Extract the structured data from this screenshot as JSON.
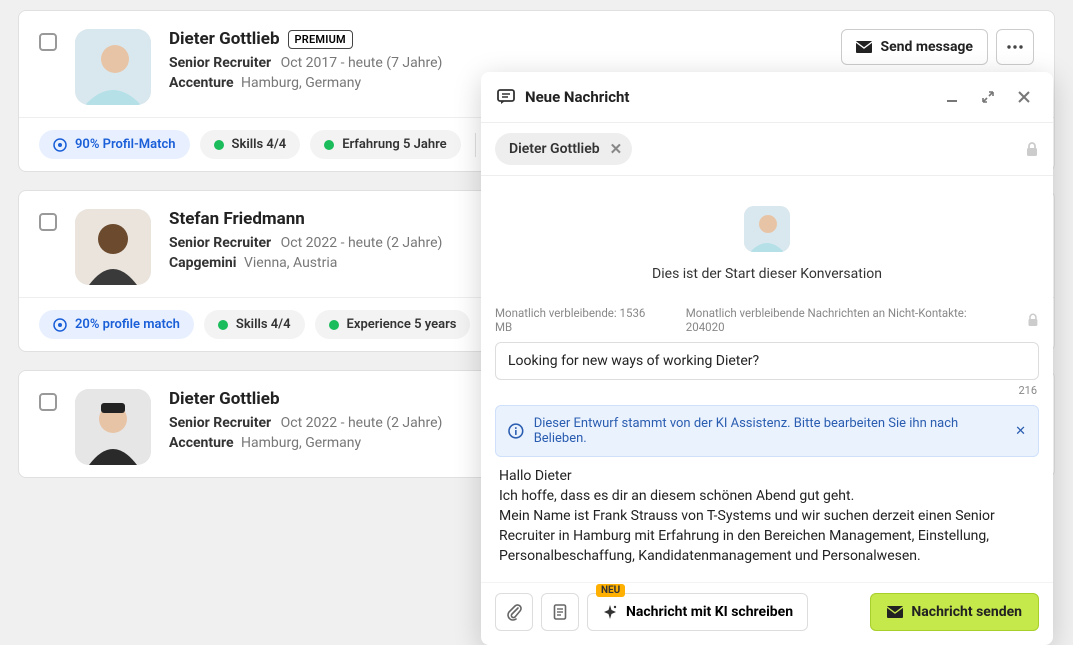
{
  "candidates": [
    {
      "name": "Dieter Gottlieb",
      "premium": "PREMIUM",
      "role": "Senior Recruiter",
      "period": "Oct 2017 - heute (7 Jahre)",
      "company": "Accenture",
      "location": "Hamburg, Germany",
      "send_label": "Send message",
      "tags": {
        "match": "90% Profil-Match",
        "skills": "Skills 4/4",
        "exp": "Erfahrung 5 Jahre"
      }
    },
    {
      "name": "Stefan Friedmann",
      "role": "Senior Recruiter",
      "period": "Oct 2022 - heute (2 Jahre)",
      "company": "Capgemini",
      "location": "Vienna, Austria",
      "tags": {
        "match": "20% profile match",
        "skills": "Skills 4/4",
        "exp": "Experience 5 years"
      }
    },
    {
      "name": "Dieter Gottlieb",
      "role": "Senior Recruiter",
      "period": "Oct 2022 - heute (2 Jahre)",
      "company": "Accenture",
      "location": "Hamburg, Germany"
    }
  ],
  "compose": {
    "title": "Neue Nachricht",
    "recipient": "Dieter Gottlieb",
    "start_text": "Dies ist der Start dieser Konversation",
    "quota_data": "Monatlich verbleibende: 1536 MB",
    "quota_msgs": "Monatlich verbleibende Nachrichten an Nicht-Kontakte: 204020",
    "subject": "Looking for new ways of working Dieter?",
    "char_count": "216",
    "ai_banner": "Dieser Entwurf stammt von der KI Assistenz. Bitte bearbeiten Sie ihn nach Belieben.",
    "body": "Hallo Dieter\nIch hoffe, dass es dir an diesem schönen Abend gut geht.\nMein Name ist Frank Strauss von T-Systems und wir suchen derzeit einen Senior Recruiter in Hamburg mit Erfahrung in den Bereichen Management, Einstellung, Personalbeschaffung, Kandidatenmanagement und Personalwesen.",
    "neu_badge": "NEU",
    "ai_button": "Nachricht mit KI schreiben",
    "send_button": "Nachricht senden"
  }
}
